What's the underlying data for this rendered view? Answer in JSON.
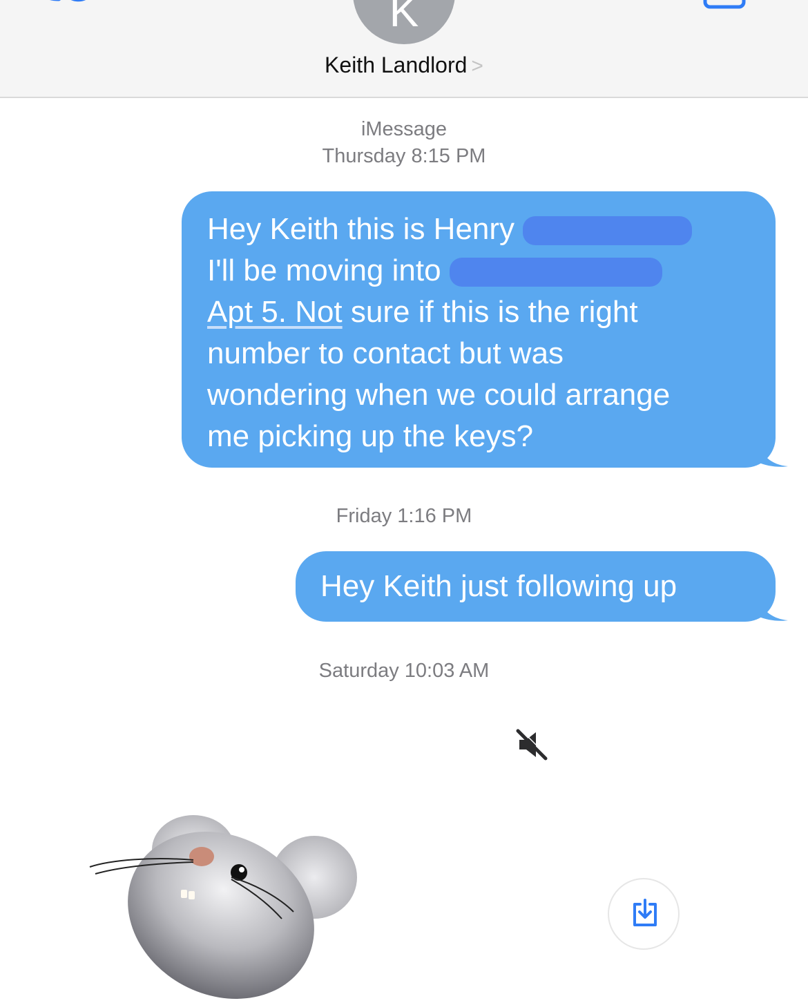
{
  "header": {
    "avatar_initial": "K",
    "contact_name": "Keith Landlord",
    "chevron": ">"
  },
  "conversation": {
    "service": "iMessage",
    "groups": [
      {
        "timestamp": "Thursday 8:15 PM",
        "message": {
          "lines": [
            "Hey Keith this is Henry",
            "I'll be moving into",
            "Apt 5. Not",
            " sure if this is the right",
            "number to contact but was",
            "wondering when we could arrange",
            "me picking up the keys?"
          ]
        }
      },
      {
        "timestamp": "Friday 1:16 PM",
        "message": {
          "text": "Hey Keith just following up"
        }
      },
      {
        "timestamp": "Saturday 10:03 AM",
        "attachment": {
          "type": "animoji",
          "character": "mouse-icon",
          "muted": true
        }
      }
    ]
  },
  "colors": {
    "bubble_blue": "#5aa8f0",
    "redaction_blue": "#4f85ee",
    "timestamp_gray": "#7c7c80",
    "accent": "#2f7cf6"
  }
}
